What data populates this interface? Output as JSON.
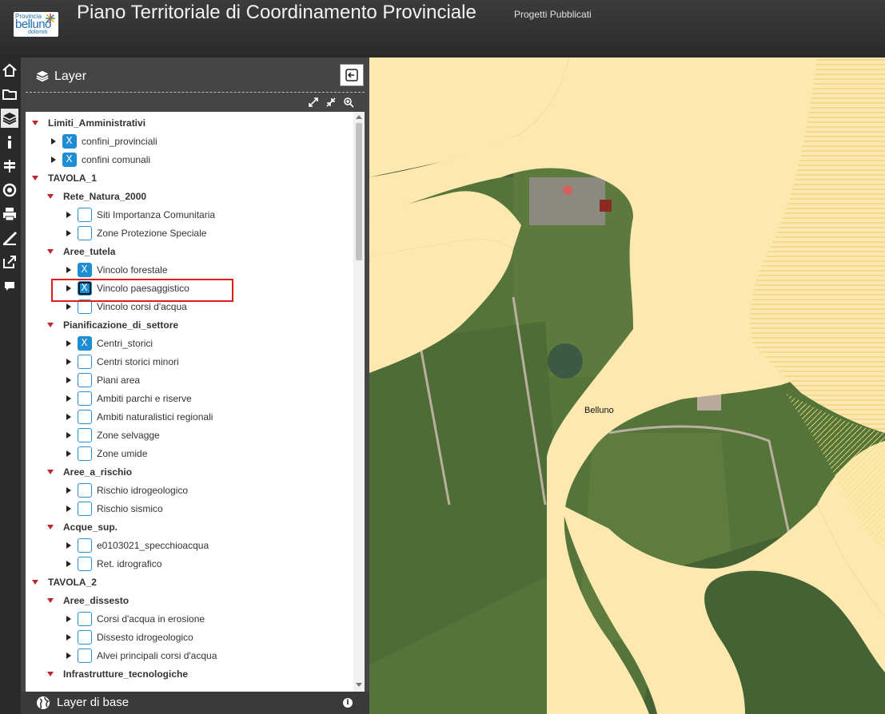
{
  "header": {
    "logo": {
      "line1": "Provincia",
      "line2": "belluno",
      "line3": "dolomiti"
    },
    "title": "Piano Territoriale di Coordinamento Provinciale",
    "subtitle": "Progetti Pubblicati"
  },
  "toolbar": {
    "tools": [
      "home-icon",
      "folder-icon",
      "layers-icon",
      "info-icon",
      "signpost-icon",
      "target-icon",
      "print-icon",
      "ruler-icon",
      "share-icon",
      "comment-icon"
    ],
    "active": "layers-icon"
  },
  "panel": {
    "title": "Layer",
    "tree": [
      {
        "kind": "group",
        "label": "Limiti_Amministrativi"
      },
      {
        "kind": "leaf",
        "label": "confini_provinciali",
        "checked": true
      },
      {
        "kind": "leaf",
        "label": "confini comunali",
        "checked": true
      },
      {
        "kind": "group",
        "label": "TAVOLA_1"
      },
      {
        "kind": "group",
        "label": "Rete_Natura_2000"
      },
      {
        "kind": "leaf",
        "label": "Siti Importanza Comunitaria",
        "checked": false
      },
      {
        "kind": "leaf",
        "label": "Zone Protezione Speciale",
        "checked": false
      },
      {
        "kind": "group",
        "label": "Aree_tutela"
      },
      {
        "kind": "leaf",
        "label": "Vincolo forestale",
        "checked": true
      },
      {
        "kind": "leaf",
        "label": "Vincolo paesaggistico",
        "checked": true,
        "focused": true
      },
      {
        "kind": "leaf",
        "label": "Vincolo corsi d'acqua",
        "checked": false
      },
      {
        "kind": "group",
        "label": "Pianificazione_di_settore"
      },
      {
        "kind": "leaf",
        "label": "Centri_storici",
        "checked": true
      },
      {
        "kind": "leaf",
        "label": "Centri storici minori",
        "checked": false
      },
      {
        "kind": "leaf",
        "label": "Piani area",
        "checked": false
      },
      {
        "kind": "leaf",
        "label": "Ambiti parchi e riserve",
        "checked": false
      },
      {
        "kind": "leaf",
        "label": "Ambiti naturalistici regionali",
        "checked": false
      },
      {
        "kind": "leaf",
        "label": "Zone selvagge",
        "checked": false
      },
      {
        "kind": "leaf",
        "label": "Zone umide",
        "checked": false
      },
      {
        "kind": "group",
        "label": "Aree_a_rischio"
      },
      {
        "kind": "leaf",
        "label": "Rischio idrogeologico",
        "checked": false
      },
      {
        "kind": "leaf",
        "label": "Rischio sismico",
        "checked": false
      },
      {
        "kind": "group",
        "label": "Acque_sup."
      },
      {
        "kind": "leaf",
        "label": "e0103021_specchioacqua",
        "checked": false
      },
      {
        "kind": "leaf",
        "label": "Ret. idrografico",
        "checked": false
      },
      {
        "kind": "group",
        "label": "TAVOLA_2"
      },
      {
        "kind": "group",
        "label": "Aree_dissesto"
      },
      {
        "kind": "leaf",
        "label": "Corsi d'acqua in erosione",
        "checked": false
      },
      {
        "kind": "leaf",
        "label": "Dissesto idrogeologico",
        "checked": false
      },
      {
        "kind": "leaf",
        "label": "Alvei principali corsi d'acqua",
        "checked": false
      },
      {
        "kind": "group",
        "label": "Infrastrutture_tecnologiche"
      }
    ],
    "base_layer": "Layer di base"
  },
  "map": {
    "place_label": "Belluno",
    "colors": {
      "overlay": "#fde9b0",
      "hatch": "#e8c25a",
      "field": "#55743a",
      "forest": "#3f5630"
    }
  }
}
